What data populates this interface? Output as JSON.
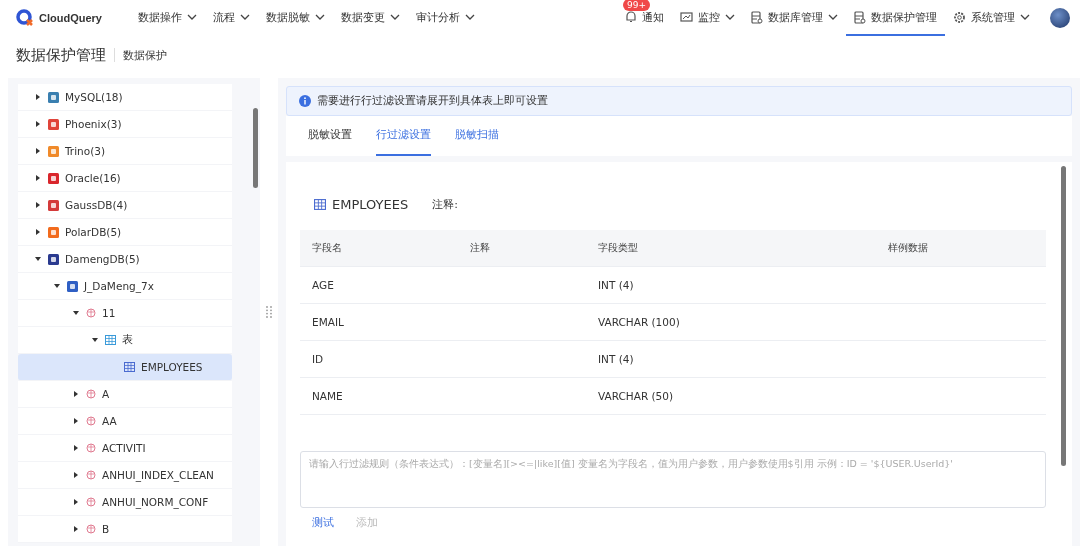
{
  "app": {
    "name": "CloudQuery"
  },
  "nav": [
    {
      "label": "数据操作",
      "dropdown": true,
      "selected": false
    },
    {
      "label": "流程",
      "dropdown": true,
      "selected": false
    },
    {
      "label": "数据脱敏",
      "dropdown": true,
      "selected": false
    },
    {
      "label": "数据变更",
      "dropdown": true,
      "selected": false
    },
    {
      "label": "审计分析",
      "dropdown": true,
      "selected": false
    }
  ],
  "nav_right": [
    {
      "label": "通知",
      "kind": "bell",
      "badge": "99+",
      "dropdown": false,
      "selected": false
    },
    {
      "label": "监控",
      "kind": "monitor",
      "dropdown": true,
      "selected": false
    },
    {
      "label": "数据库管理",
      "kind": "database",
      "dropdown": true,
      "selected": false
    },
    {
      "label": "数据保护管理",
      "kind": "database",
      "dropdown": false,
      "selected": true
    },
    {
      "label": "系统管理",
      "kind": "gear",
      "dropdown": true,
      "selected": false
    }
  ],
  "breadcrumb": {
    "title": "数据保护管理",
    "subtitle": "数据保护"
  },
  "tree": [
    {
      "label": "MySQL(18)",
      "kind": "mysql",
      "expanded": false,
      "selected": false
    },
    {
      "label": "Phoenix(3)",
      "kind": "phoenix",
      "expanded": false,
      "selected": false
    },
    {
      "label": "Trino(3)",
      "kind": "trino",
      "expanded": false,
      "selected": false
    },
    {
      "label": "Oracle(16)",
      "kind": "oracle",
      "expanded": false,
      "selected": false
    },
    {
      "label": "GaussDB(4)",
      "kind": "gauss",
      "expanded": false,
      "selected": false
    },
    {
      "label": "PolarDB(5)",
      "kind": "polar",
      "expanded": false,
      "selected": false
    },
    {
      "label": "DamengDB(5)",
      "kind": "dameng",
      "expanded": true,
      "selected": false,
      "children": [
        {
          "label": "J_DaMeng_7x",
          "kind": "connection",
          "expanded": true,
          "selected": false,
          "children": [
            {
              "label": "11",
              "kind": "schema",
              "expanded": true,
              "selected": false,
              "children": [
                {
                  "label": "表",
                  "kind": "folder",
                  "expanded": true,
                  "selected": false,
                  "children": [
                    {
                      "label": "EMPLOYEES",
                      "kind": "table",
                      "selected": true
                    }
                  ]
                }
              ]
            },
            {
              "label": "A",
              "kind": "schema",
              "expanded": false,
              "selected": false
            },
            {
              "label": "AA",
              "kind": "schema",
              "expanded": false,
              "selected": false
            },
            {
              "label": "ACTIVITI",
              "kind": "schema",
              "expanded": false,
              "selected": false
            },
            {
              "label": "ANHUI_INDEX_CLEAN",
              "kind": "schema",
              "expanded": false,
              "selected": false
            },
            {
              "label": "ANHUI_NORM_CONF",
              "kind": "schema",
              "expanded": false,
              "selected": false
            },
            {
              "label": "B",
              "kind": "schema",
              "expanded": false,
              "selected": false
            }
          ]
        }
      ]
    }
  ],
  "alert": {
    "text": "需要进行行过滤设置请展开到具体表上即可设置"
  },
  "tabs": [
    {
      "label": "脱敏设置",
      "selected": false
    },
    {
      "label": "行过滤设置",
      "selected": true
    },
    {
      "label": "脱敏扫描",
      "selected": false
    }
  ],
  "table_title": {
    "name": "EMPLOYEES",
    "comment_label": "注释:"
  },
  "table": {
    "columns": [
      "字段名",
      "注释",
      "字段类型",
      "样例数据"
    ],
    "rows": [
      {
        "name": "AGE",
        "type": "INT (4)"
      },
      {
        "name": "EMAIL",
        "type": "VARCHAR (100)"
      },
      {
        "name": "ID",
        "type": "INT (4)"
      },
      {
        "name": "NAME",
        "type": "VARCHAR (50)"
      }
    ]
  },
  "filter": {
    "placeholder": "请输入行过滤规则（条件表达式）：[变量名][><=|like][值] 变量名为字段名，值为用户参数，用户参数使用$引用 示例：ID = '${USER.UserId}'"
  },
  "actions": [
    {
      "label": "测试",
      "disabled": false
    },
    {
      "label": "添加",
      "disabled": true
    }
  ]
}
